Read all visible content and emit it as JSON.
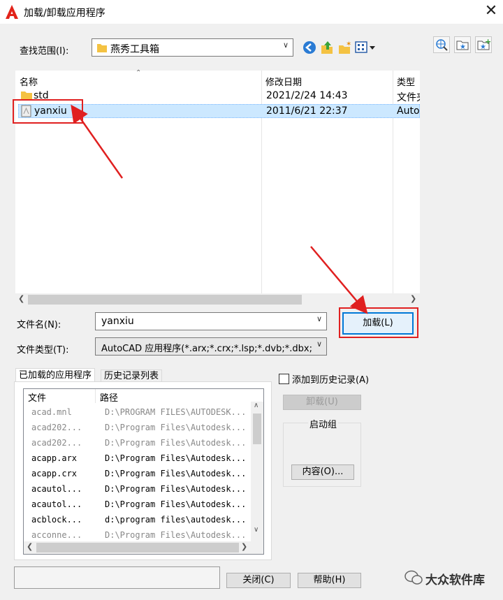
{
  "window": {
    "title": "加载/卸载应用程序",
    "close_symbol": "✕"
  },
  "lookin": {
    "label": "查找范围(I):",
    "value": "燕秀工具箱"
  },
  "filelist": {
    "columns": [
      "名称",
      "修改日期",
      "类型"
    ],
    "rows": [
      {
        "name": "std",
        "date": "2021/2/24 14:43",
        "type": "文件夹",
        "icon": "folder-icon",
        "selected": false
      },
      {
        "name": "yanxiu",
        "date": "2011/6/21 22:37",
        "type": "Auto",
        "icon": "file-icon",
        "selected": true
      }
    ]
  },
  "filename": {
    "label": "文件名(N):",
    "value": "yanxiu"
  },
  "filetype": {
    "label": "文件类型(T):",
    "value": "AutoCAD 应用程序(*.arx;*.crx;*.lsp;*.dvb;*.dbx;"
  },
  "load_button": "加载(L)",
  "tabs": [
    "已加载的应用程序",
    "历史记录列表"
  ],
  "applist": {
    "columns": [
      "文件",
      "路径"
    ],
    "rows": [
      {
        "file": "acad.mnl",
        "path": "D:\\PROGRAM FILES\\AUTODESK...",
        "dim": true
      },
      {
        "file": "acad202...",
        "path": "D:\\Program Files\\Autodesk...",
        "dim": true
      },
      {
        "file": "acad202...",
        "path": "D:\\Program Files\\Autodesk...",
        "dim": true
      },
      {
        "file": "acapp.arx",
        "path": "D:\\Program Files\\Autodesk...",
        "dim": false
      },
      {
        "file": "acapp.crx",
        "path": "D:\\Program Files\\Autodesk...",
        "dim": false
      },
      {
        "file": "acautol...",
        "path": "D:\\Program Files\\Autodesk...",
        "dim": false
      },
      {
        "file": "acautol...",
        "path": "D:\\Program Files\\Autodesk...",
        "dim": false
      },
      {
        "file": "acblock...",
        "path": "d:\\program files\\autodesk...",
        "dim": false
      },
      {
        "file": "acconne...",
        "path": "D:\\Program Files\\Autodesk...",
        "dim": true
      }
    ]
  },
  "add_history": {
    "label": "添加到历史记录(A)",
    "checked": false
  },
  "unload_button": "卸载(U)",
  "startup_group": {
    "label": "启动组",
    "contents_button": "内容(O)..."
  },
  "close_button": "关闭(C)",
  "help_button": "帮助(H)",
  "watermark": "大众软件库",
  "colors": {
    "annotation_red": "#e02020",
    "selection": "#cce8ff",
    "button_focus": "#0078d7"
  }
}
